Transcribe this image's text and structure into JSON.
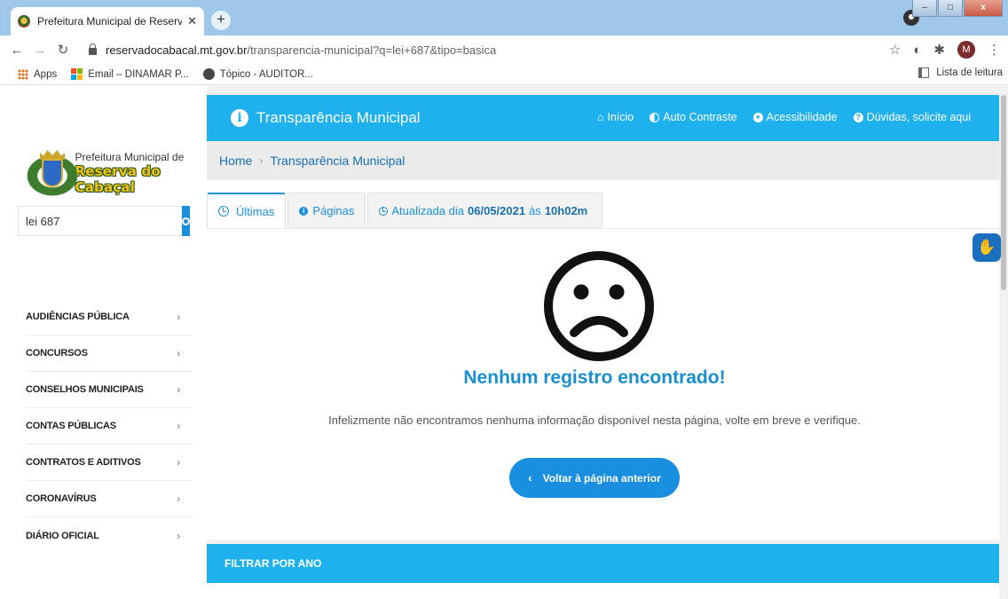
{
  "browser": {
    "tab_title": "Prefeitura Municipal de Reserva d",
    "tab_close": "✕",
    "new_tab": "+",
    "url_host": "reservadocabacal.mt.gov.br",
    "url_path": "/transparencia-municipal?q=lei+687&tipo=basica",
    "profile_initial": "M",
    "bookmarks": [
      "Apps",
      "Email – DINAMAR P...",
      "Tópico - AUDITOR..."
    ],
    "reading_list": "Lista de leitura"
  },
  "sidebar": {
    "logo_line1": "Prefeitura Municipal de",
    "logo_line2": "Reserva do Cabaçal",
    "search_value": "lei 687",
    "menu": [
      "AUDIÊNCIAS PÚBLICA",
      "CONCURSOS",
      "CONSELHOS MUNICIPAIS",
      "CONTAS PÚBLICAS",
      "CONTRATOS E ADITIVOS",
      "CORONAVÍRUS",
      "DIÁRIO OFICIAL"
    ]
  },
  "header": {
    "title": "Transparência Municipal",
    "nav": {
      "inicio": "Início",
      "contraste": "Auto Contraste",
      "acessibilidade": "Acessibilidade",
      "duvidas": "Dúvidas, solicite aqui"
    }
  },
  "breadcrumb": {
    "home": "Home",
    "current": "Transparência Municipal"
  },
  "tabs": {
    "ultimas": "Últimas",
    "paginas": "Páginas",
    "updated_prefix": "Atualizada dia",
    "updated_date": "06/05/2021",
    "updated_mid": "às",
    "updated_time": "10h02m"
  },
  "empty": {
    "title": "Nenhum registro encontrado!",
    "text": "Infelizmente não encontramos nenhuma informação disponível nesta página, volte em breve e verifique.",
    "back_button": "Voltar à página anterior"
  },
  "filter": {
    "title": "FILTRAR POR ANO"
  },
  "colors": {
    "accent": "#1fb1ee",
    "button": "#1a8fe0",
    "heading": "#1a8fcf"
  }
}
